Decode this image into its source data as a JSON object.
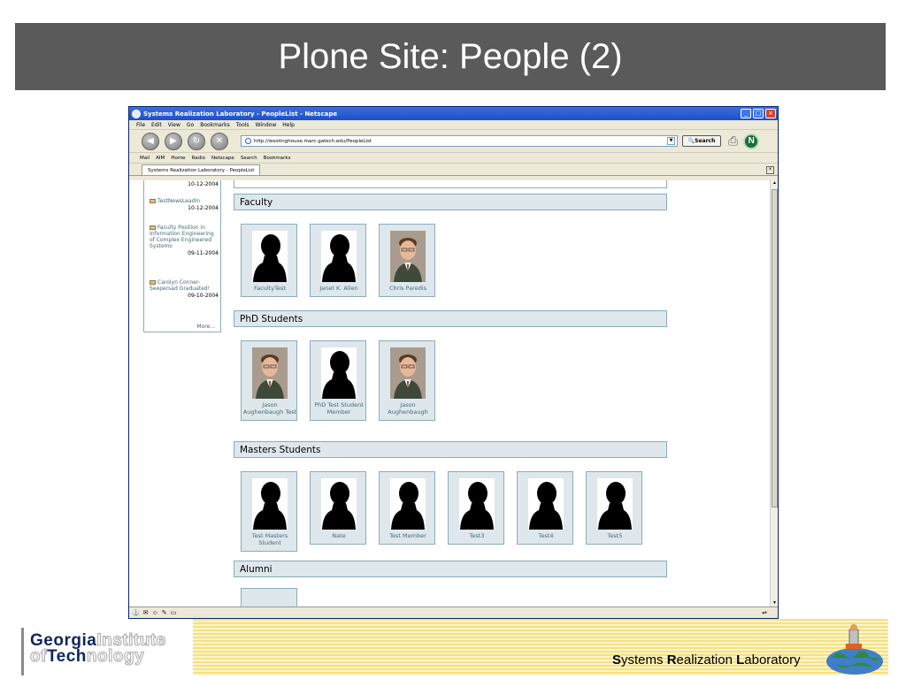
{
  "slide": {
    "title": "Plone Site: People (2)"
  },
  "browser": {
    "window_title": "Systems Realization Laboratory - PeopleList - Netscape",
    "menu": [
      "File",
      "Edit",
      "View",
      "Go",
      "Bookmarks",
      "Tools",
      "Window",
      "Help"
    ],
    "url": "http://westinghouse.marc.gatech.edu/PeopleList",
    "search_label": "Search",
    "personal_toolbar": [
      "Mail",
      "AIM",
      "Home",
      "Radio",
      "Netscape",
      "Search",
      "Bookmarks"
    ],
    "tab_label": "Systems Realization Laboratory - PeopleList"
  },
  "news": {
    "items": [
      {
        "title": "",
        "date": "10-12-2004"
      },
      {
        "title": "TestNewsLeadIn",
        "date": "10-12-2004"
      },
      {
        "title": "Faculty Position in Information Engineering of Complex Engineered Systems",
        "date": "09-11-2004"
      },
      {
        "title": "Carolyn Conner-Seepersad Graduated!",
        "date": "09-10-2004"
      }
    ],
    "more_label": "More..."
  },
  "sections": {
    "faculty": {
      "heading": "Faculty",
      "people": [
        {
          "name": "FacultyTest",
          "photo": "silhouette"
        },
        {
          "name": "Janet K. Allen",
          "photo": "silhouette"
        },
        {
          "name": "Chris Paredis",
          "photo": "portrait"
        }
      ]
    },
    "phd": {
      "heading": "PhD Students",
      "people": [
        {
          "name": "Jason Aughenbaugh Test",
          "photo": "portrait"
        },
        {
          "name": "PhD Test Student Member",
          "photo": "silhouette"
        },
        {
          "name": "Jason Aughenbaugh",
          "photo": "portrait"
        }
      ]
    },
    "masters": {
      "heading": "Masters Students",
      "people": [
        {
          "name": "Test Masters Student",
          "photo": "silhouette"
        },
        {
          "name": "Nate",
          "photo": "silhouette"
        },
        {
          "name": "Test Member",
          "photo": "silhouette"
        },
        {
          "name": "Test3",
          "photo": "silhouette"
        },
        {
          "name": "Test4",
          "photo": "silhouette"
        },
        {
          "name": "Test5",
          "photo": "silhouette"
        }
      ]
    },
    "alumni": {
      "heading": "Alumni"
    }
  },
  "footer": {
    "logo_line1_dark": "Georgia",
    "logo_line1_light": "Institute",
    "logo_line2_light": "of",
    "logo_line2_dark": "Tech",
    "logo_line2_light2": "nology",
    "lab_name_parts": [
      "S",
      "ystems ",
      "R",
      "ealization ",
      "L",
      "aboratory"
    ]
  },
  "colors": {
    "title_bar": "#5a5a5a",
    "section_bg": "#dee7ec",
    "section_border": "#8cacbb",
    "link": "#436976",
    "stripe": "#f7e080"
  }
}
